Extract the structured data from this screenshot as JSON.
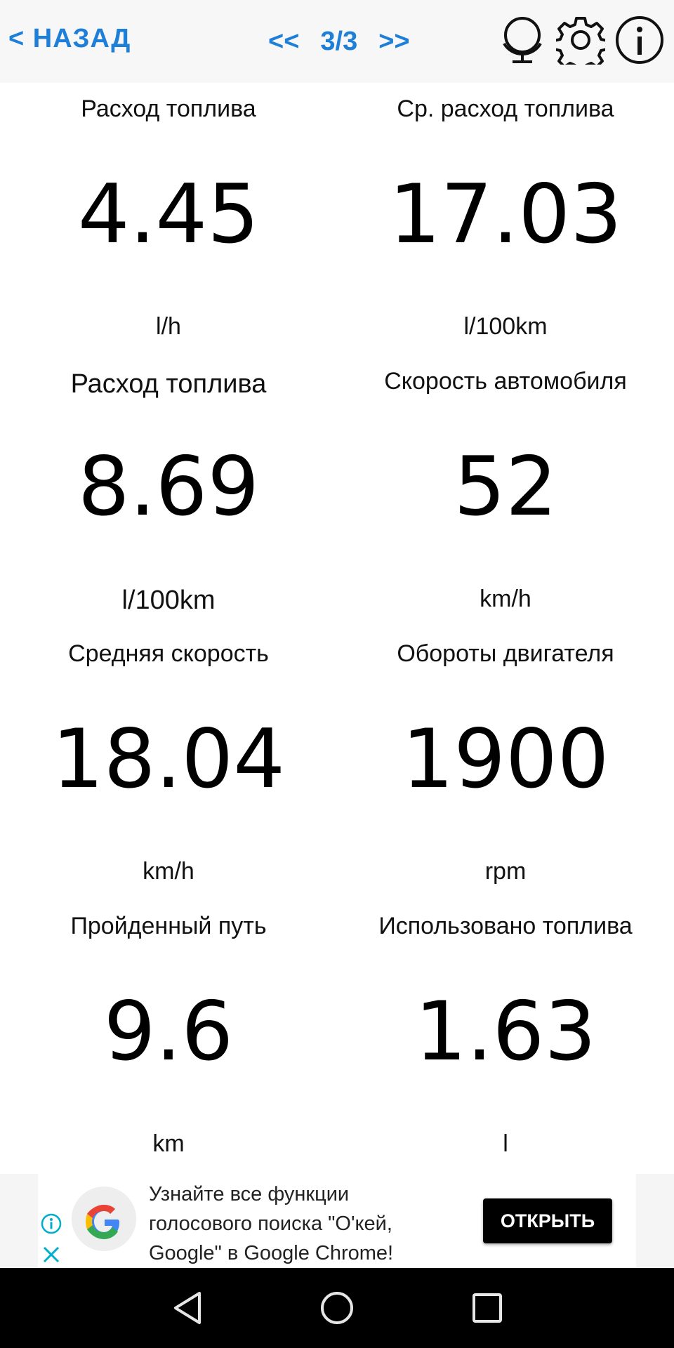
{
  "header": {
    "back_label": "< НАЗАД",
    "prev_label": "<<",
    "page_indicator": "3/3",
    "next_label": ">>",
    "icons": [
      "globe-icon",
      "gear-icon",
      "info-icon"
    ]
  },
  "metrics": [
    {
      "label": "Расход топлива",
      "value": "4.45",
      "unit": "l/h"
    },
    {
      "label": "Ср. расход топлива",
      "value": "17.03",
      "unit": "l/100km"
    },
    {
      "label": "Расход топлива",
      "value": "8.69",
      "unit": "l/100km"
    },
    {
      "label": "Скорость автомобиля",
      "value": "52",
      "unit": "km/h"
    },
    {
      "label": "Средняя скорость",
      "value": "18.04",
      "unit": "km/h"
    },
    {
      "label": "Обороты двигателя",
      "value": "1900",
      "unit": "rpm"
    },
    {
      "label": "Пройденный путь",
      "value": "9.6",
      "unit": "km"
    },
    {
      "label": "Использовано топлива",
      "value": "1.63",
      "unit": "l"
    }
  ],
  "ad": {
    "text_line1": "Узнайте все функции",
    "text_line2": "голосового поиска \"О'кей,",
    "text_line3": "Google\" в Google Chrome!",
    "button_label": "ОТКРЫТЬ"
  },
  "colors": {
    "accent": "#1e7fd8",
    "topbar_bg": "#f7f7f7",
    "navbar_bg": "#000000"
  }
}
